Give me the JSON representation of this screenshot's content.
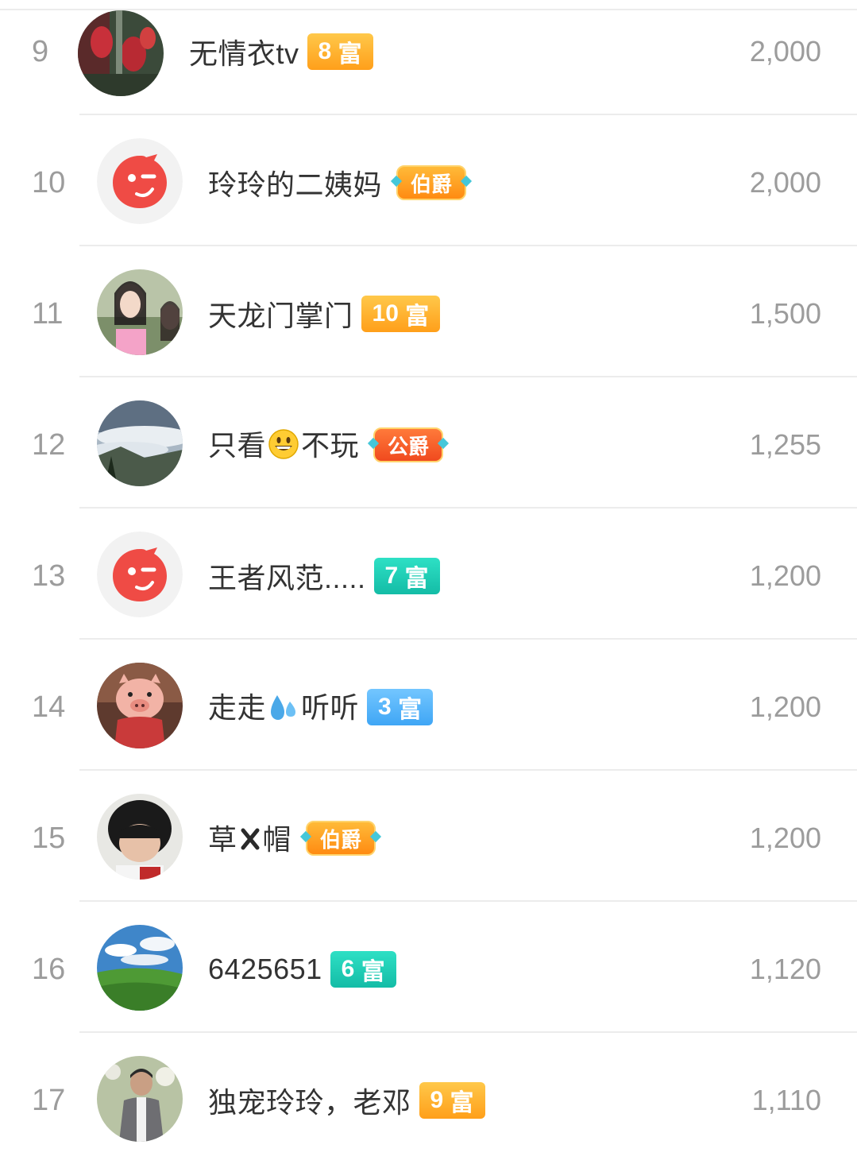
{
  "rows": [
    {
      "rank": "9",
      "name": "无情衣tv",
      "badge_num": "8",
      "badge_text": "富",
      "badge_style": "rich-orange",
      "score": "2,000",
      "avatar": "forest-photo"
    },
    {
      "rank": "10",
      "name": "玲玲的二姨妈",
      "badge_num": "",
      "badge_text": "伯爵",
      "badge_style": "noble gold",
      "score": "2,000",
      "avatar": "default-mascot"
    },
    {
      "rank": "11",
      "name": "天龙门掌门",
      "badge_num": "10",
      "badge_text": "富",
      "badge_style": "rich-orange",
      "score": "1,500",
      "avatar": "women-photo"
    },
    {
      "rank": "12",
      "name_before": "只看",
      "name_after": "不玩",
      "emoji": "grinning-face",
      "badge_num": "",
      "badge_text": "公爵",
      "badge_style": "noble red",
      "score": "1,255",
      "avatar": "mountain-clouds-photo"
    },
    {
      "rank": "13",
      "name": "王者风范.....",
      "badge_num": "7",
      "badge_text": "富",
      "badge_style": "rich-teal",
      "score": "1,200",
      "avatar": "default-mascot"
    },
    {
      "rank": "14",
      "name_before": "走走",
      "name_after": "听听",
      "emoji": "sweat-droplets",
      "badge_num": "3",
      "badge_text": "富",
      "badge_style": "rich-blue",
      "score": "1,200",
      "avatar": "pig-cartoon"
    },
    {
      "rank": "15",
      "name_before": "草",
      "name_after": "帽",
      "emoji": "cross-mark",
      "badge_num": "",
      "badge_text": "伯爵",
      "badge_style": "noble gold",
      "score": "1,200",
      "avatar": "boy-photo"
    },
    {
      "rank": "16",
      "name": "6425651",
      "badge_num": "6",
      "badge_text": "富",
      "badge_style": "rich-teal",
      "score": "1,120",
      "avatar": "grass-sky-photo"
    },
    {
      "rank": "17",
      "name": "独宠玲玲，老邓",
      "badge_num": "9",
      "badge_text": "富",
      "badge_style": "rich-orange",
      "score": "1,110",
      "avatar": "man-photo"
    }
  ]
}
